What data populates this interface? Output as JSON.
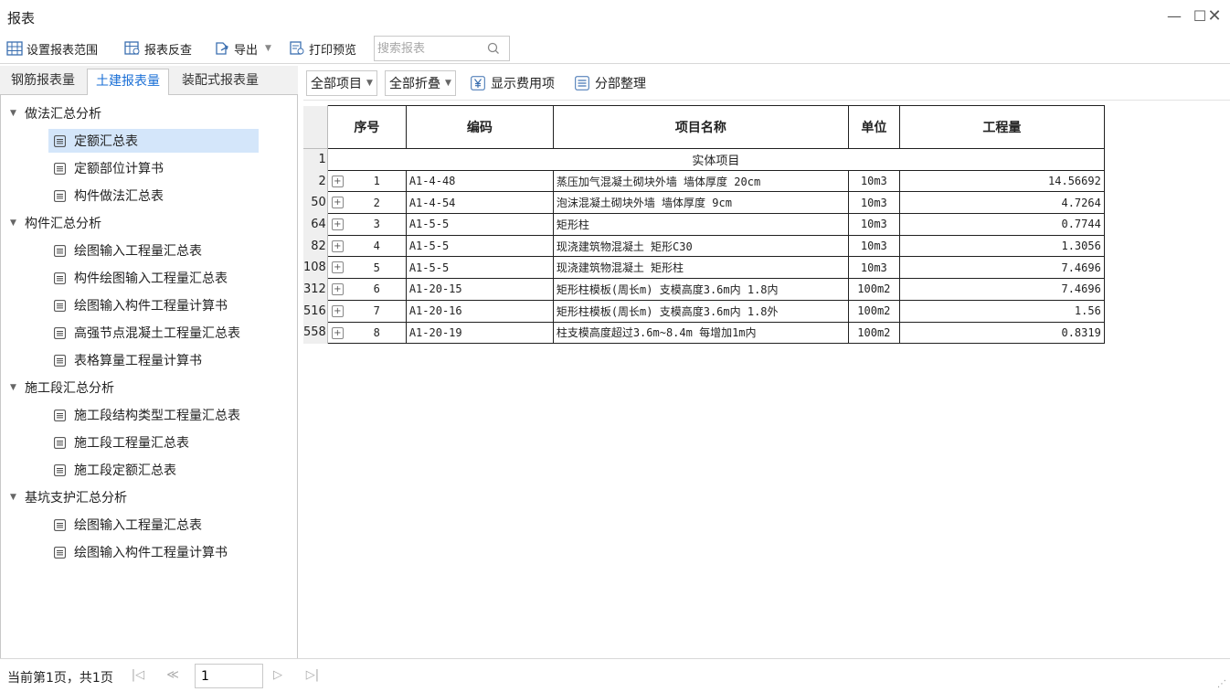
{
  "window": {
    "title": "报表"
  },
  "toolbar": {
    "set_range": "设置报表范围",
    "reverse_check": "报表反查",
    "export": "导出",
    "print_preview": "打印预览",
    "search_placeholder": "搜索报表"
  },
  "left_tabs": [
    "钢筋报表量",
    "土建报表量",
    "装配式报表量"
  ],
  "active_tab": 1,
  "tree": {
    "groups": [
      {
        "label": "做法汇总分析",
        "items": [
          "定额汇总表",
          "定额部位计算书",
          "构件做法汇总表"
        ]
      },
      {
        "label": "构件汇总分析",
        "items": [
          "绘图输入工程量汇总表",
          "构件绘图输入工程量汇总表",
          "绘图输入构件工程量计算书",
          "高强节点混凝土工程量汇总表",
          "表格算量工程量计算书"
        ]
      },
      {
        "label": "施工段汇总分析",
        "items": [
          "施工段结构类型工程量汇总表",
          "施工段工程量汇总表",
          "施工段定额汇总表"
        ]
      },
      {
        "label": "基坑支护汇总分析",
        "items": [
          "绘图输入工程量汇总表",
          "绘图输入构件工程量计算书"
        ]
      }
    ],
    "selected_item": "定额汇总表"
  },
  "right_toolbar": {
    "all_items": "全部项目",
    "all_collapse": "全部折叠",
    "show_fee": "显示费用项",
    "section_sort": "分部整理"
  },
  "grid": {
    "headers": [
      "序号",
      "编码",
      "项目名称",
      "单位",
      "工程量"
    ],
    "section_row": {
      "row_no": "1",
      "label": "实体项目"
    },
    "rows": [
      {
        "row_no": "2",
        "seq": "1",
        "code": "A1-4-48",
        "name": "蒸压加气混凝土砌块外墙 墙体厚度 20cm",
        "unit": "10m3",
        "qty": "14.56692"
      },
      {
        "row_no": "50",
        "seq": "2",
        "code": "A1-4-54",
        "name": "泡沫混凝土砌块外墙 墙体厚度 9cm",
        "unit": "10m3",
        "qty": "4.7264"
      },
      {
        "row_no": "64",
        "seq": "3",
        "code": "A1-5-5",
        "name": "矩形柱",
        "unit": "10m3",
        "qty": "0.7744"
      },
      {
        "row_no": "82",
        "seq": "4",
        "code": "A1-5-5",
        "name": "现浇建筑物混凝土 矩形C30",
        "unit": "10m3",
        "qty": "1.3056"
      },
      {
        "row_no": "108",
        "seq": "5",
        "code": "A1-5-5",
        "name": "现浇建筑物混凝土 矩形柱",
        "unit": "10m3",
        "qty": "7.4696"
      },
      {
        "row_no": "312",
        "seq": "6",
        "code": "A1-20-15",
        "name": "矩形柱模板(周长m) 支模高度3.6m内 1.8内",
        "unit": "100m2",
        "qty": "7.4696"
      },
      {
        "row_no": "516",
        "seq": "7",
        "code": "A1-20-16",
        "name": "矩形柱模板(周长m) 支模高度3.6m内 1.8外",
        "unit": "100m2",
        "qty": "1.56"
      },
      {
        "row_no": "558",
        "seq": "8",
        "code": "A1-20-19",
        "name": "柱支模高度超过3.6m~8.4m 每增加1m内",
        "unit": "100m2",
        "qty": "0.8319"
      }
    ]
  },
  "status": {
    "page_text": "当前第1页，共1页",
    "page_value": "1"
  },
  "colors": {
    "accent": "#1a6fd6",
    "selected_bg": "#d4e6fa"
  }
}
